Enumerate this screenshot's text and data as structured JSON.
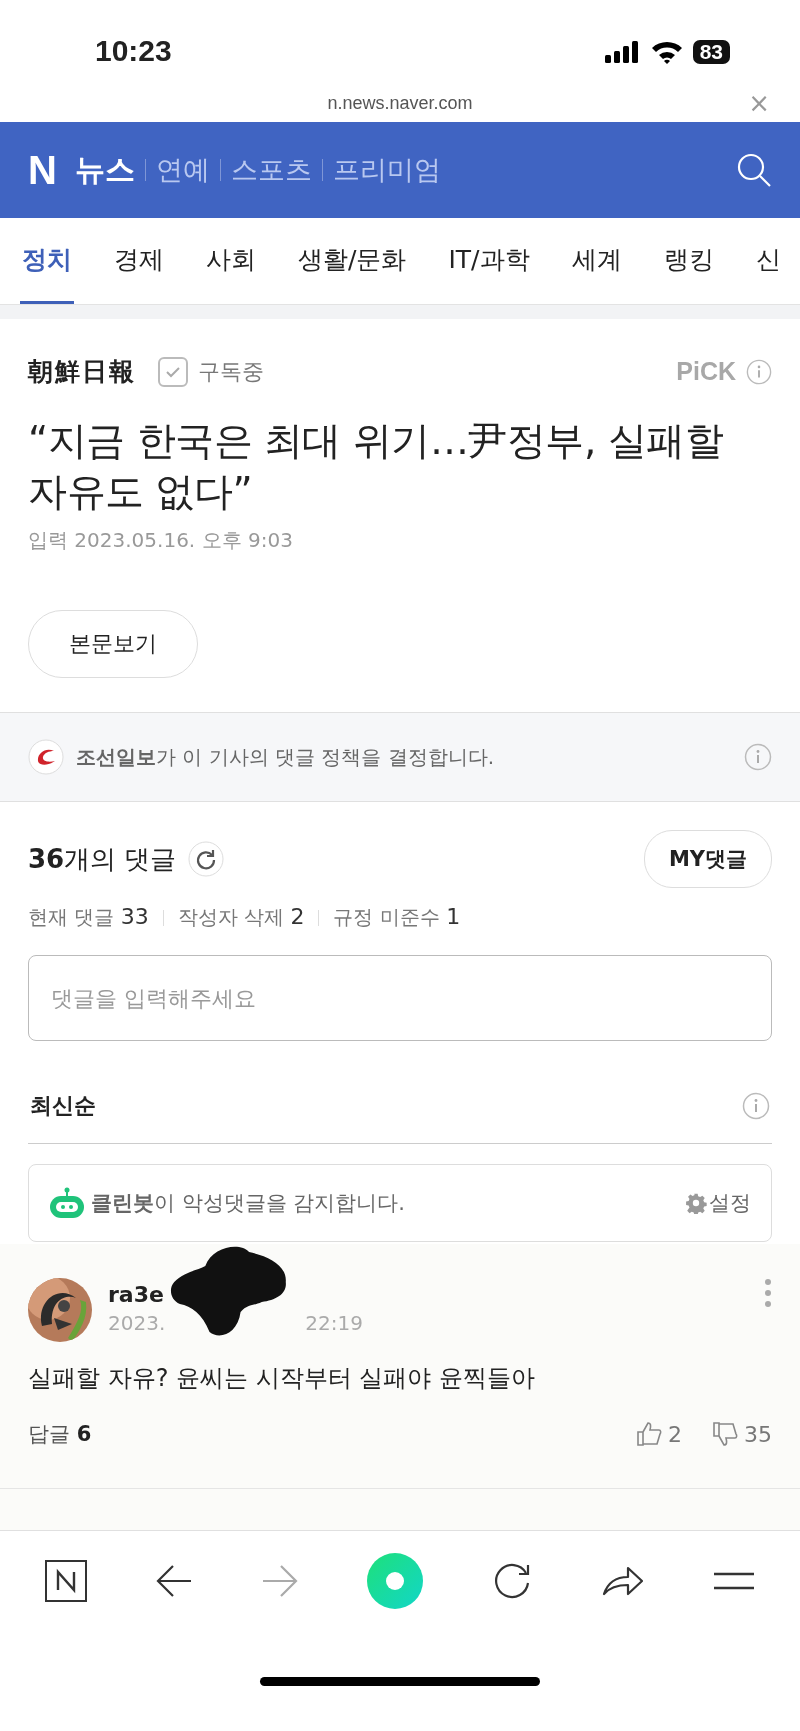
{
  "status_bar": {
    "time": "10:23",
    "battery": "83"
  },
  "browser": {
    "url": "n.news.naver.com",
    "close": "×"
  },
  "header": {
    "logo": "N",
    "title": "뉴스",
    "links": [
      "연예",
      "스포츠",
      "프리미엄"
    ]
  },
  "tabs": [
    {
      "label": "정치",
      "selected": true
    },
    {
      "label": "경제",
      "selected": false
    },
    {
      "label": "사회",
      "selected": false
    },
    {
      "label": "생활/문화",
      "selected": false
    },
    {
      "label": "IT/과학",
      "selected": false
    },
    {
      "label": "세계",
      "selected": false
    },
    {
      "label": "랭킹",
      "selected": false
    },
    {
      "label": "신",
      "selected": false
    }
  ],
  "article": {
    "press": "朝鮮日報",
    "subscription": {
      "label": "구독중",
      "checked": true
    },
    "pick": "PiCK",
    "title": "“지금 한국은 최대 위기…尹정부, 실패할 자유도 없다”",
    "date_label": "입력",
    "date": "2023.05.16. 오후 9:03",
    "body_button": "본문보기"
  },
  "policy": {
    "text": "**조선일보**가 이 기사의 댓글 정책을 결정합니다."
  },
  "comments": {
    "count": "36",
    "count_suffix": "개의 댓글",
    "my_button": "MY댓글",
    "stats": [
      {
        "label": "현재 댓글",
        "value": "33"
      },
      {
        "label": "작성자 삭제",
        "value": "2"
      },
      {
        "label": "규정 미준수",
        "value": "1"
      }
    ],
    "input": {
      "placeholder": "댓글을 입력해주세요"
    },
    "sort": "최신순",
    "cleanbot": {
      "text": "**클린봇**이 악성댓글을 감지합니다.",
      "settings": "설정"
    },
    "items": [
      {
        "user": "ra3e",
        "date_start": "2023.",
        "date_end": "22:19",
        "text": "실패할 자유? 윤씨는 시작부터 실패야 윤찍들아",
        "reply_label": "답글",
        "replies": "6",
        "likes": "2",
        "dislikes": "35"
      }
    ]
  },
  "toolbar": [
    {
      "kind": "home",
      "disabled": false
    },
    {
      "kind": "back",
      "disabled": false
    },
    {
      "kind": "forward",
      "disabled": true
    },
    {
      "kind": "green",
      "disabled": false
    },
    {
      "kind": "reload",
      "disabled": false
    },
    {
      "kind": "share",
      "disabled": false
    },
    {
      "kind": "menu",
      "disabled": false
    }
  ]
}
